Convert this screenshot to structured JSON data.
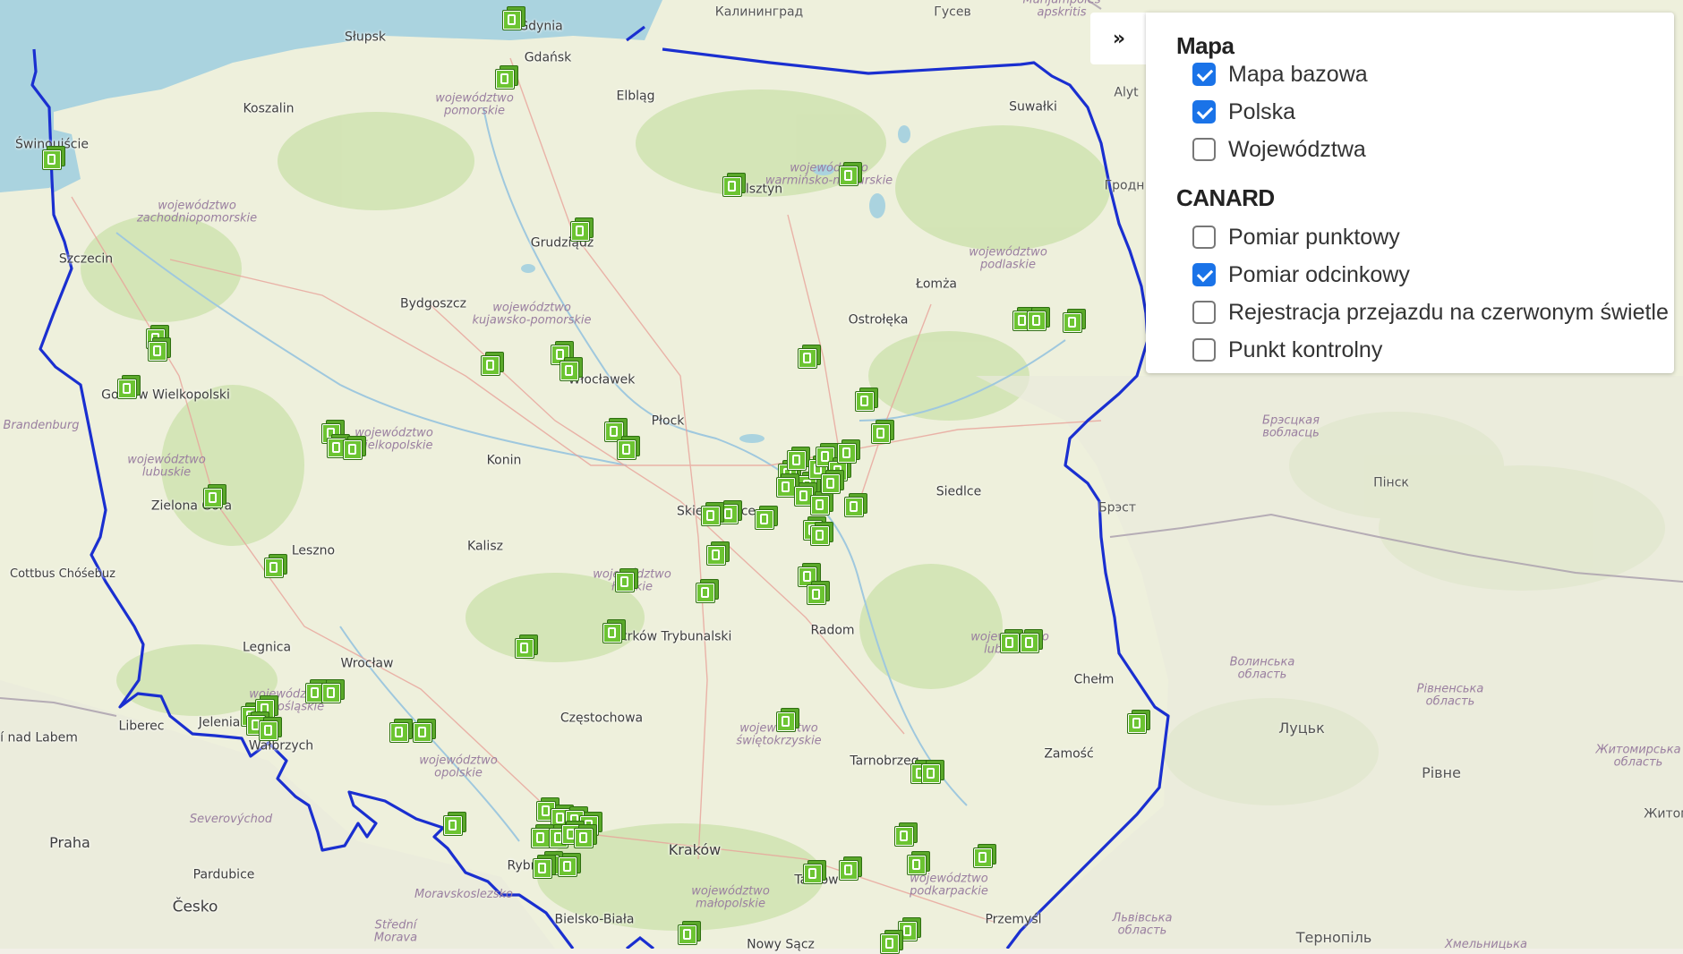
{
  "colors": {
    "water": "#aad3df",
    "land": "#eef0dc",
    "border": "#1a2fd0",
    "marker": "#6cc432"
  },
  "controls": {
    "toggle_label": "»",
    "sections": [
      {
        "title": "Mapa",
        "items": [
          {
            "label": "Mapa bazowa",
            "checked": true
          },
          {
            "label": "Polska",
            "checked": true
          },
          {
            "label": "Województwa",
            "checked": false
          }
        ]
      },
      {
        "title": "CANARD",
        "items": [
          {
            "label": "Pomiar punktowy",
            "checked": false
          },
          {
            "label": "Pomiar odcinkowy",
            "checked": true
          },
          {
            "label": "Rejestracja przejazdu na czerwonym świetle",
            "checked": false
          },
          {
            "label": "Punkt kontrolny",
            "checked": false
          }
        ]
      }
    ]
  },
  "map": {
    "cities": [
      "Gdynia",
      "Gdańsk",
      "Słupsk",
      "Koszalin",
      "Świnoujście",
      "Elbląg",
      "Olsztyn",
      "Grudziądz",
      "Szczecin",
      "Bydgoszcz",
      "Gorzów Wielkopolski",
      "Włocławek",
      "Płock",
      "Konin",
      "Łomża",
      "Ostrołęka",
      "Suwałki",
      "Zielona Góra",
      "Leszno",
      "Kalisz",
      "Skierniewice",
      "Siedlce",
      "Piotrków Trybunalski",
      "Radom",
      "Legnica",
      "Wrocław",
      "Jelenia",
      "Wałbrzych",
      "Częstochowa",
      "Tarnobrzeg",
      "Zamość",
      "Chełm",
      "Kraków",
      "Bielsko-Biała",
      "Nowy Sącz",
      "Przemyśl",
      "Tarnów",
      "Rybnik",
      "Cottbus Chóśebuz",
      "Liberec",
      "Ústí nad Labem",
      "Praha",
      "Pardubice",
      "Česko",
      "Калининград",
      "Гусев",
      "Брэст",
      "Пінск",
      "Луцьк",
      "Рівне",
      "Тернопіль",
      "Гродн",
      "Житом",
      "Alyt"
    ],
    "regions": [
      "województwo pomorskie",
      "województwo zachodniopomorskie",
      "województwo warmińsko-mazurskie",
      "województwo kujawsko-pomorskie",
      "województwo podlaskie",
      "województwo wielkopolskie",
      "województwo lubuskie",
      "województwo łódzkie",
      "województwo dolnośląskie",
      "województwo opolskie",
      "województwo świętokrzyskie",
      "województwo lubelskie",
      "województwo małopolskie",
      "województwo podkarpackie",
      "Brandenburg",
      "Severovýchod",
      "Moravskoslezsko",
      "Střední Morava",
      "Брэсцкая вобласць",
      "Волинська область",
      "Рівненська область",
      "Житомирська область",
      "Львівська область",
      "Хмельницька",
      "Marijampolės apskritis"
    ]
  }
}
